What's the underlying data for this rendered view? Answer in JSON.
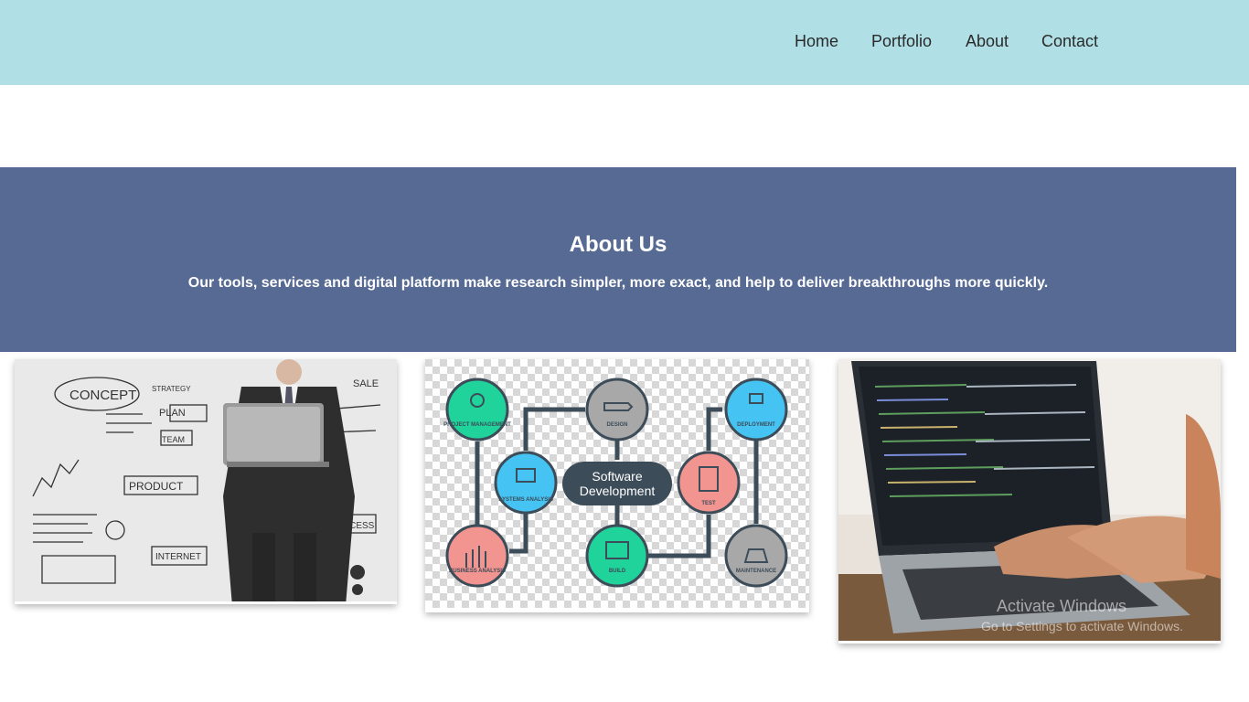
{
  "nav": {
    "items": [
      {
        "label": "Home"
      },
      {
        "label": "Portfolio"
      },
      {
        "label": "About"
      },
      {
        "label": "Contact"
      }
    ]
  },
  "hero": {
    "title": "About Us",
    "subtitle": "Our tools, services and digital platform make research simpler, more exact, and help to deliver breakthroughs more quickly."
  },
  "cards": {
    "business": {
      "labels": [
        "CONCEPT",
        "PLAN",
        "TEAM",
        "PRODUCT",
        "INTERNET",
        "STRATEGY",
        "SALE",
        "SUCCESS"
      ]
    },
    "software": {
      "center": [
        "Software",
        "Development"
      ],
      "nodes": [
        "PROJECT MANAGEMENT",
        "DESIGN",
        "DEPLOYMENT",
        "SYSTEMS ANALYSIS",
        "TEST",
        "BUSINESS ANALYSIS",
        "BUILD",
        "MAINTENANCE"
      ]
    }
  },
  "watermark": {
    "line1": "Activate Windows",
    "line2": "Go to Settings to activate Windows."
  },
  "colors": {
    "navbar": "#b0dfe5",
    "hero": "#566a94",
    "teal": "#1fd39a",
    "blue": "#45c3f2",
    "pink": "#f2948f",
    "gray": "#a8a8a8",
    "dark": "#3d4c59"
  }
}
